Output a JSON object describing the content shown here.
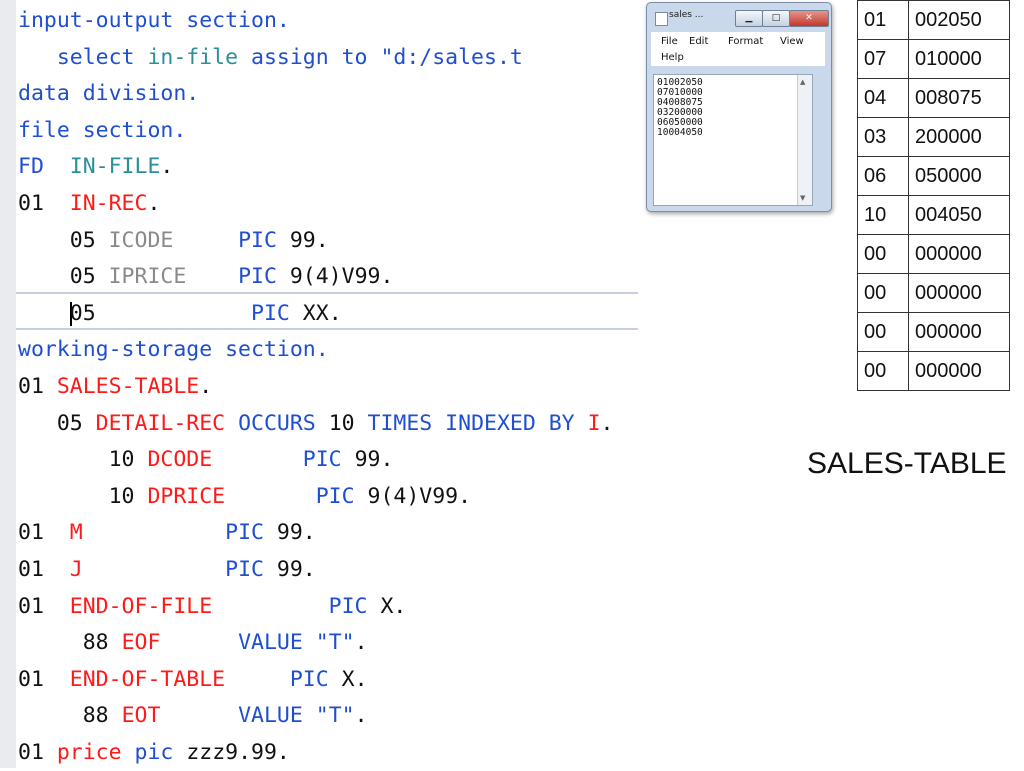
{
  "code": {
    "lines": [
      {
        "segments": [
          {
            "t": "input-output section.",
            "c": "kw"
          }
        ]
      },
      {
        "segments": [
          {
            "t": "   select ",
            "c": "kw"
          },
          {
            "t": "in-file",
            "c": "tn"
          },
          {
            "t": " assign to \"d:/sales.t",
            "c": "kw"
          }
        ]
      },
      {
        "segments": [
          {
            "t": "data division.",
            "c": "kw"
          }
        ]
      },
      {
        "segments": [
          {
            "t": "file section.",
            "c": "kw"
          }
        ]
      },
      {
        "segments": [
          {
            "t": "FD",
            "c": "kw"
          },
          {
            "t": "  ",
            "c": "bk"
          },
          {
            "t": "IN-FILE",
            "c": "tn"
          },
          {
            "t": ".",
            "c": "bk"
          }
        ]
      },
      {
        "segments": [
          {
            "t": "01",
            "c": "bk"
          },
          {
            "t": "  ",
            "c": "bk"
          },
          {
            "t": "IN-REC",
            "c": "dn"
          },
          {
            "t": ".",
            "c": "bk"
          }
        ]
      },
      {
        "segments": [
          {
            "t": "    05 ",
            "c": "bk"
          },
          {
            "t": "ICODE",
            "c": "gr"
          },
          {
            "t": "     ",
            "c": "bk"
          },
          {
            "t": "PIC",
            "c": "kw"
          },
          {
            "t": " 99.",
            "c": "bk"
          }
        ]
      },
      {
        "segments": [
          {
            "t": "    05 ",
            "c": "bk"
          },
          {
            "t": "IPRICE",
            "c": "gr"
          },
          {
            "t": "    ",
            "c": "bk"
          },
          {
            "t": "PIC",
            "c": "kw"
          },
          {
            "t": " 9(4)V99.",
            "c": "bk"
          }
        ]
      },
      {
        "segments": [
          {
            "t": "    05",
            "c": "bk"
          },
          {
            "t": "            ",
            "c": "bk"
          },
          {
            "t": "PIC",
            "c": "kw"
          },
          {
            "t": " XX.",
            "c": "bk"
          }
        ],
        "caret": true
      },
      {
        "segments": [
          {
            "t": "working-storage section.",
            "c": "kw"
          }
        ]
      },
      {
        "segments": [
          {
            "t": "01 ",
            "c": "bk"
          },
          {
            "t": "SALES-TABLE",
            "c": "dn"
          },
          {
            "t": ".",
            "c": "bk"
          }
        ]
      },
      {
        "segments": [
          {
            "t": "   05 ",
            "c": "bk"
          },
          {
            "t": "DETAIL-REC",
            "c": "dn"
          },
          {
            "t": " OCCURS ",
            "c": "kw"
          },
          {
            "t": "10",
            "c": "bk"
          },
          {
            "t": " TIMES INDEXED BY ",
            "c": "kw"
          },
          {
            "t": "I",
            "c": "dn"
          },
          {
            "t": ".",
            "c": "bk"
          }
        ]
      },
      {
        "segments": [
          {
            "t": "       10 ",
            "c": "bk"
          },
          {
            "t": "DCODE",
            "c": "dn"
          },
          {
            "t": "       ",
            "c": "bk"
          },
          {
            "t": "PIC",
            "c": "kw"
          },
          {
            "t": " 99.",
            "c": "bk"
          }
        ]
      },
      {
        "segments": [
          {
            "t": "       10 ",
            "c": "bk"
          },
          {
            "t": "DPRICE",
            "c": "dn"
          },
          {
            "t": "       ",
            "c": "bk"
          },
          {
            "t": "PIC",
            "c": "kw"
          },
          {
            "t": " 9(4)V99.",
            "c": "bk"
          }
        ]
      },
      {
        "segments": [
          {
            "t": "01",
            "c": "bk"
          },
          {
            "t": "  ",
            "c": "bk"
          },
          {
            "t": "M",
            "c": "dn"
          },
          {
            "t": "           ",
            "c": "bk"
          },
          {
            "t": "PIC",
            "c": "kw"
          },
          {
            "t": " 99.",
            "c": "bk"
          }
        ]
      },
      {
        "segments": [
          {
            "t": "01",
            "c": "bk"
          },
          {
            "t": "  ",
            "c": "bk"
          },
          {
            "t": "J",
            "c": "dn"
          },
          {
            "t": "           ",
            "c": "bk"
          },
          {
            "t": "PIC",
            "c": "kw"
          },
          {
            "t": " 99.",
            "c": "bk"
          }
        ]
      },
      {
        "segments": [
          {
            "t": "01",
            "c": "bk"
          },
          {
            "t": "  ",
            "c": "bk"
          },
          {
            "t": "END-OF-FILE",
            "c": "dn"
          },
          {
            "t": "         ",
            "c": "bk"
          },
          {
            "t": "PIC",
            "c": "kw"
          },
          {
            "t": " X.",
            "c": "bk"
          }
        ]
      },
      {
        "segments": [
          {
            "t": "     88 ",
            "c": "bk"
          },
          {
            "t": "EOF",
            "c": "dn"
          },
          {
            "t": "      ",
            "c": "bk"
          },
          {
            "t": "VALUE ",
            "c": "kw"
          },
          {
            "t": "\"T\"",
            "c": "st"
          },
          {
            "t": ".",
            "c": "bk"
          }
        ]
      },
      {
        "segments": [
          {
            "t": "01",
            "c": "bk"
          },
          {
            "t": "  ",
            "c": "bk"
          },
          {
            "t": "END-OF-TABLE",
            "c": "dn"
          },
          {
            "t": "     ",
            "c": "bk"
          },
          {
            "t": "PIC",
            "c": "kw"
          },
          {
            "t": " X.",
            "c": "bk"
          }
        ]
      },
      {
        "segments": [
          {
            "t": "     88 ",
            "c": "bk"
          },
          {
            "t": "EOT",
            "c": "dn"
          },
          {
            "t": "      ",
            "c": "bk"
          },
          {
            "t": "VALUE ",
            "c": "kw"
          },
          {
            "t": "\"T\"",
            "c": "st"
          },
          {
            "t": ".",
            "c": "bk"
          }
        ]
      },
      {
        "segments": [
          {
            "t": "01 ",
            "c": "bk"
          },
          {
            "t": "price",
            "c": "dn"
          },
          {
            "t": " pic ",
            "c": "kw"
          },
          {
            "t": "zzz9.99.",
            "c": "bk"
          }
        ]
      }
    ]
  },
  "notepad": {
    "title": "sales ...",
    "minimize": "▁",
    "maximize": "□",
    "close": "✕",
    "menu": [
      "File",
      "Edit",
      "Format",
      "View",
      "Help"
    ],
    "content": "01002050\n07010000\n04008075\n03200000\n06050000\n10004050"
  },
  "table": {
    "rows": [
      [
        "01",
        "002050"
      ],
      [
        "07",
        "010000"
      ],
      [
        "04",
        "008075"
      ],
      [
        "03",
        "200000"
      ],
      [
        "06",
        "050000"
      ],
      [
        "10",
        "004050"
      ],
      [
        "00",
        "000000"
      ],
      [
        "00",
        "000000"
      ],
      [
        "00",
        "000000"
      ],
      [
        "00",
        "000000"
      ]
    ],
    "caption": "SALES-TABLE"
  },
  "icons": {
    "notepad": "notepad-file-icon",
    "scroll_up": "scroll-up-arrow-icon",
    "scroll_down": "scroll-down-arrow-icon"
  }
}
